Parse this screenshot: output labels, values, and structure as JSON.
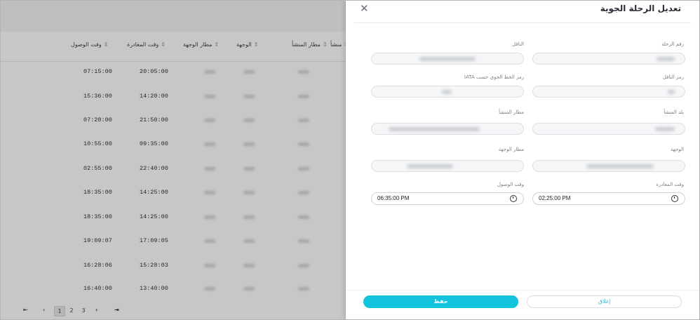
{
  "table": {
    "columns": [
      {
        "label": "وقت الوصول"
      },
      {
        "label": "وقت المغادرة"
      },
      {
        "label": "مطار الوجهة"
      },
      {
        "label": "الوجهة"
      },
      {
        "label": "مطار المنشأ"
      },
      {
        "label": "منشأ"
      }
    ],
    "rows": [
      {
        "arrival": "07:15:00",
        "departure": "20:05:00"
      },
      {
        "arrival": "15:36:00",
        "departure": "14:20:00"
      },
      {
        "arrival": "07:20:00",
        "departure": "21:50:00"
      },
      {
        "arrival": "10:55:00",
        "departure": "09:35:00"
      },
      {
        "arrival": "02:55:00",
        "departure": "22:40:00"
      },
      {
        "arrival": "18:35:00",
        "departure": "14:25:00"
      },
      {
        "arrival": "18:35:00",
        "departure": "14:25:00"
      },
      {
        "arrival": "19:09:07",
        "departure": "17:09:05"
      },
      {
        "arrival": "16:28:06",
        "departure": "15:28:03"
      },
      {
        "arrival": "16:40:00",
        "departure": "13:40:00"
      }
    ]
  },
  "pagination": {
    "first": "⇤",
    "prev": "‹",
    "pages": [
      "1",
      "2",
      "3"
    ],
    "next": "›",
    "last": "⇥"
  },
  "drawer": {
    "title": "تعديل الرحلة الجوية",
    "close_icon": "close-icon",
    "fields": {
      "flight_number": {
        "label": "رقم الرحلة"
      },
      "carrier": {
        "label": "الناقل"
      },
      "carrier_code": {
        "label": "رمز الناقل"
      },
      "iata_code": {
        "label": "رمز الخط الجوي حسب IATA"
      },
      "origin_country": {
        "label": "بلد المنشأ"
      },
      "origin_airport": {
        "label": "مطار المنشأ"
      },
      "destination": {
        "label": "الوجهة"
      },
      "destination_airport": {
        "label": "مطار الوجهة"
      },
      "departure_time": {
        "label": "وقت المغادرة",
        "value": "02:25:00 PM"
      },
      "arrival_time": {
        "label": "وقت الوصول",
        "value": "06:35:00 PM"
      }
    },
    "save_label": "حفظ",
    "close_label": "إغلاق"
  },
  "colors": {
    "accent": "#12c3dd",
    "overlay": "rgba(0,0,0,0.22)"
  }
}
